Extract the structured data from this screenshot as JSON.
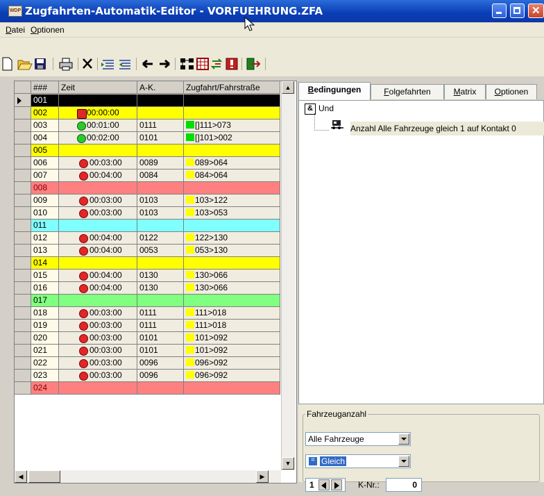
{
  "window": {
    "title": "Zugfahrten-Automatik-Editor - VORFUEHRUNG.ZFA",
    "app_icon_text": "WDP"
  },
  "menu": [
    {
      "label": "Datei",
      "accel": "D",
      "rest": "atei"
    },
    {
      "label": "Optionen",
      "accel": "O",
      "rest": "ptionen"
    }
  ],
  "toolbar": [
    "new-file-icon",
    "open-folder-icon",
    "save-icon",
    "print-icon",
    "delete-icon",
    "indent-icon",
    "outdent-icon",
    "arrow-left-icon",
    "arrow-right-icon",
    "network-icon",
    "table-icon",
    "swap-icon",
    "alert-icon",
    "exit-icon"
  ],
  "grid": {
    "columns": [
      "###",
      "Zeit",
      "A-K.",
      "Zugfahrt/Fahrstraße"
    ],
    "colors": {
      "yellow": "#ffff00",
      "cream": "#fffbe8",
      "red": "#ff8080",
      "cyan": "#80ffff",
      "green": "#80ff80",
      "beige": "#f0ece0",
      "black": "#000000"
    },
    "rows": [
      {
        "num": "001",
        "time": "",
        "ak": "",
        "route": "",
        "bg": "black",
        "time_icon": "",
        "sw": ""
      },
      {
        "num": "002",
        "time": "00:00:00",
        "ak": "",
        "route": "",
        "bg": "yellow",
        "time_icon": "signal",
        "sw": ""
      },
      {
        "num": "003",
        "time": "00:01:00",
        "ak": "0111",
        "route": "[]111>073",
        "bg": "beige",
        "time_icon": "green",
        "sw": "#00e000"
      },
      {
        "num": "004",
        "time": "00:02:00",
        "ak": "0101",
        "route": "[]101>002",
        "bg": "beige",
        "time_icon": "green",
        "sw": "#00e000"
      },
      {
        "num": "005",
        "time": "",
        "ak": "",
        "route": "",
        "bg": "yellow",
        "time_icon": "",
        "sw": ""
      },
      {
        "num": "006",
        "time": "00:03:00",
        "ak": "0089",
        "route": "089>064",
        "bg": "beige",
        "time_icon": "red",
        "sw": "#ffff00"
      },
      {
        "num": "007",
        "time": "00:04:00",
        "ak": "0084",
        "route": "084>064",
        "bg": "beige",
        "time_icon": "red",
        "sw": "#ffff00"
      },
      {
        "num": "008",
        "time": "",
        "ak": "",
        "route": "",
        "bg": "red",
        "time_icon": "",
        "sw": ""
      },
      {
        "num": "009",
        "time": "00:03:00",
        "ak": "0103",
        "route": "103>122",
        "bg": "beige",
        "time_icon": "red",
        "sw": "#ffff00"
      },
      {
        "num": "010",
        "time": "00:03:00",
        "ak": "0103",
        "route": "103>053",
        "bg": "beige",
        "time_icon": "red",
        "sw": "#ffff00"
      },
      {
        "num": "011",
        "time": "",
        "ak": "",
        "route": "",
        "bg": "cyan",
        "time_icon": "",
        "sw": ""
      },
      {
        "num": "012",
        "time": "00:04:00",
        "ak": "0122",
        "route": "122>130",
        "bg": "beige",
        "time_icon": "red",
        "sw": "#ffff00"
      },
      {
        "num": "013",
        "time": "00:04:00",
        "ak": "0053",
        "route": "053>130",
        "bg": "beige",
        "time_icon": "red",
        "sw": "#ffff00"
      },
      {
        "num": "014",
        "time": "",
        "ak": "",
        "route": "",
        "bg": "yellow",
        "time_icon": "",
        "sw": ""
      },
      {
        "num": "015",
        "time": "00:04:00",
        "ak": "0130",
        "route": "130>066",
        "bg": "beige",
        "time_icon": "red",
        "sw": "#ffff00"
      },
      {
        "num": "016",
        "time": "00:04:00",
        "ak": "0130",
        "route": "130>066",
        "bg": "beige",
        "time_icon": "red",
        "sw": "#ffff00"
      },
      {
        "num": "017",
        "time": "",
        "ak": "",
        "route": "",
        "bg": "green",
        "time_icon": "",
        "sw": ""
      },
      {
        "num": "018",
        "time": "00:03:00",
        "ak": "0111",
        "route": "111>018",
        "bg": "beige",
        "time_icon": "red",
        "sw": "#ffff00"
      },
      {
        "num": "019",
        "time": "00:03:00",
        "ak": "0111",
        "route": "111>018",
        "bg": "beige",
        "time_icon": "red",
        "sw": "#ffff00"
      },
      {
        "num": "020",
        "time": "00:03:00",
        "ak": "0101",
        "route": "101>092",
        "bg": "beige",
        "time_icon": "red",
        "sw": "#ffff00"
      },
      {
        "num": "021",
        "time": "00:03:00",
        "ak": "0101",
        "route": "101>092",
        "bg": "beige",
        "time_icon": "red",
        "sw": "#ffff00"
      },
      {
        "num": "022",
        "time": "00:03:00",
        "ak": "0096",
        "route": "096>092",
        "bg": "beige",
        "time_icon": "red",
        "sw": "#ffff00"
      },
      {
        "num": "023",
        "time": "00:03:00",
        "ak": "0096",
        "route": "096>092",
        "bg": "beige",
        "time_icon": "red",
        "sw": "#ffff00"
      },
      {
        "num": "024",
        "time": "",
        "ak": "",
        "route": "",
        "bg": "red",
        "time_icon": "",
        "sw": ""
      }
    ]
  },
  "tabs": [
    {
      "label": "Bedingungen",
      "accel": "B",
      "rest": "edingungen",
      "active": true
    },
    {
      "label": "Folgefahrten",
      "accel": "F",
      "rest": "olgefahrten",
      "active": false
    },
    {
      "label": "Matrix",
      "accel": "M",
      "rest": "atrix",
      "active": false
    },
    {
      "label": "Optionen",
      "accel": "O",
      "rest": "ptionen",
      "active": false
    }
  ],
  "conditions": {
    "root_label": "Und",
    "root_icon_text": "&",
    "item": "Anzahl Alle Fahrzeuge gleich 1 auf Kontakt 0"
  },
  "vehicle_count": {
    "group_label": "Fahrzeuganzahl",
    "selector": "Alle Fahrzeuge",
    "operator": "Gleich",
    "operator_icon": "=",
    "count": "1",
    "contact_label": "K-Nr.:",
    "contact_value": "0"
  }
}
